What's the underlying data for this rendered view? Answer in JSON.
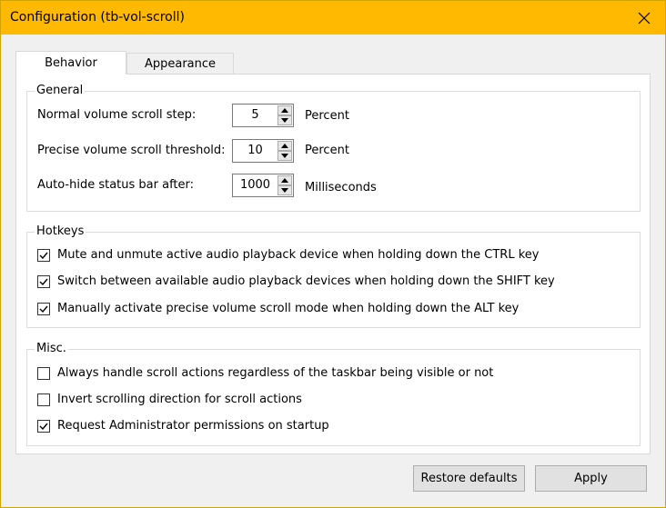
{
  "window": {
    "title": "Configuration (tb-vol-scroll)",
    "accent": "#ffb900"
  },
  "tabs": [
    {
      "label": "Behavior",
      "selected": true
    },
    {
      "label": "Appearance",
      "selected": false
    }
  ],
  "general": {
    "legend": "General",
    "rows": [
      {
        "label": "Normal volume scroll step:",
        "value": "5",
        "unit": "Percent"
      },
      {
        "label": "Precise volume scroll threshold:",
        "value": "10",
        "unit": "Percent"
      },
      {
        "label": "Auto-hide status bar after:",
        "value": "1000",
        "unit": "Milliseconds"
      }
    ]
  },
  "hotkeys": {
    "legend": "Hotkeys",
    "options": [
      {
        "label": "Mute and unmute active audio playback device when holding down the CTRL key",
        "checked": true
      },
      {
        "label": "Switch between available audio playback devices when holding down the SHIFT key",
        "checked": true
      },
      {
        "label": "Manually activate precise volume scroll mode when holding down the ALT key",
        "checked": true
      }
    ]
  },
  "misc": {
    "legend": "Misc.",
    "options": [
      {
        "label": "Always handle scroll actions regardless of the taskbar being visible or not",
        "checked": false
      },
      {
        "label": "Invert scrolling direction for scroll actions",
        "checked": false
      },
      {
        "label": "Request Administrator permissions on startup",
        "checked": true
      }
    ]
  },
  "buttons": {
    "restore_label": "Restore defaults",
    "apply_label": "Apply"
  }
}
